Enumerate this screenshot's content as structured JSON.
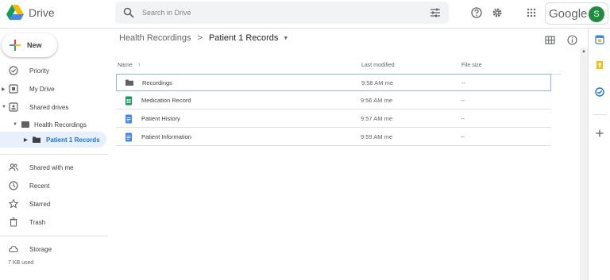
{
  "app": {
    "name": "Drive"
  },
  "search": {
    "placeholder": "Search in Drive"
  },
  "header": {
    "brand": "Google",
    "avatar_letter": "S"
  },
  "sidebar": {
    "new_label": "New",
    "items": [
      {
        "label": "Priority",
        "icon": "priority-icon"
      },
      {
        "label": "My Drive",
        "icon": "my-drive-icon"
      },
      {
        "label": "Shared drives",
        "icon": "shared-drives-icon"
      },
      {
        "label": "Health Recordings",
        "icon": "shared-drive-icon"
      },
      {
        "label": "Patient 1 Records",
        "icon": "folder-icon"
      },
      {
        "label": "Shared with me",
        "icon": "people-icon"
      },
      {
        "label": "Recent",
        "icon": "clock-icon"
      },
      {
        "label": "Starred",
        "icon": "star-icon"
      },
      {
        "label": "Trash",
        "icon": "trash-icon"
      },
      {
        "label": "Storage",
        "icon": "cloud-icon"
      }
    ],
    "storage_used": "7 KB used"
  },
  "breadcrumb": {
    "parent": "Health Recordings",
    "current": "Patient 1 Records"
  },
  "table": {
    "columns": {
      "name": "Name",
      "modified": "Last modified",
      "size": "File size"
    },
    "rows": [
      {
        "name": "Recordings",
        "type": "folder",
        "modified": "9:58 AM  me",
        "size": "--"
      },
      {
        "name": "Medication Record",
        "type": "sheet",
        "modified": "9:56 AM  me",
        "size": "--"
      },
      {
        "name": "Patient History",
        "type": "doc",
        "modified": "9:57 AM  me",
        "size": "--"
      },
      {
        "name": "Patient Information",
        "type": "doc",
        "modified": "9:59 AM  me",
        "size": "--"
      }
    ]
  },
  "colors": {
    "accent": "#1a73e8",
    "active_bg": "#e8f0fe",
    "sheet_green": "#0f9d58",
    "doc_blue": "#4285f4"
  }
}
